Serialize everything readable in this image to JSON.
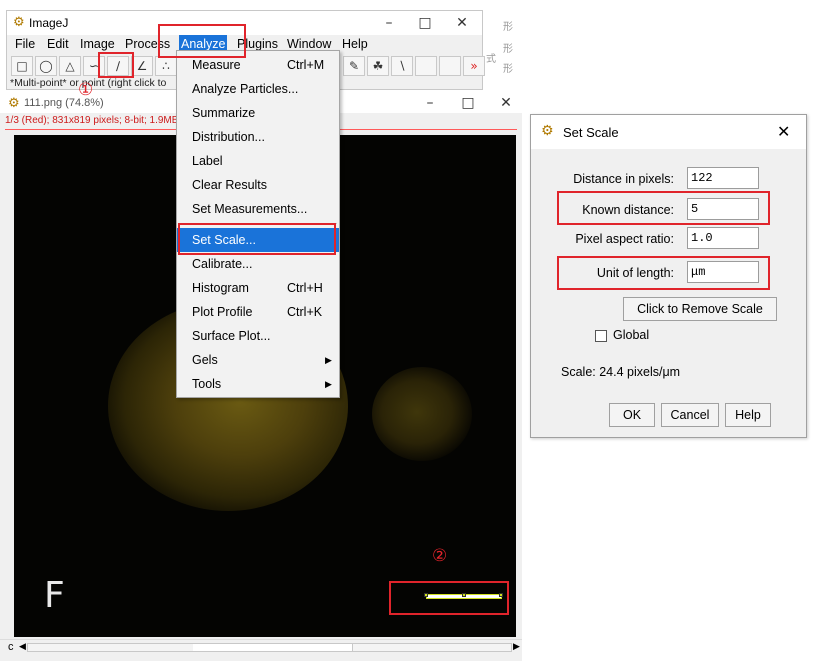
{
  "main_window": {
    "title": "ImageJ",
    "menus": [
      "File",
      "Edit",
      "Image",
      "Process",
      "Analyze",
      "Plugins",
      "Window",
      "Help"
    ],
    "active_menu": "Analyze",
    "status_text": "*Multi-point* or point (right click to"
  },
  "image_window": {
    "title": "111.png (74.8%)",
    "info": "1/3 (Red); 831x819 pixels; 8-bit; 1.9MB",
    "overlay_letter": "F",
    "scroll_left_label": "c"
  },
  "analyze_menu": {
    "items": [
      {
        "label": "Measure",
        "shortcut": "Ctrl+M"
      },
      {
        "label": "Analyze Particles..."
      },
      {
        "label": "Summarize"
      },
      {
        "label": "Distribution..."
      },
      {
        "label": "Label"
      },
      {
        "label": "Clear Results"
      },
      {
        "label": "Set Measurements..."
      },
      {
        "label": "Set Scale...",
        "selected": true
      },
      {
        "label": "Calibrate..."
      },
      {
        "label": "Histogram",
        "shortcut": "Ctrl+H"
      },
      {
        "label": "Plot Profile",
        "shortcut": "Ctrl+K"
      },
      {
        "label": "Surface Plot..."
      },
      {
        "label": "Gels",
        "submenu": true
      },
      {
        "label": "Tools",
        "submenu": true
      }
    ]
  },
  "set_scale_dialog": {
    "title": "Set Scale",
    "distance_in_pixels": {
      "label": "Distance in pixels:",
      "value": "122"
    },
    "known_distance": {
      "label": "Known distance:",
      "value": "5"
    },
    "pixel_aspect_ratio": {
      "label": "Pixel aspect ratio:",
      "value": "1.0"
    },
    "unit_of_length": {
      "label": "Unit of length:",
      "value": "μm"
    },
    "remove_scale_button": "Click to Remove Scale",
    "global_checkbox": {
      "label": "Global",
      "checked": false
    },
    "scale_text": "Scale: 24.4 pixels/μm",
    "ok_button": "OK",
    "cancel_button": "Cancel",
    "help_button": "Help"
  },
  "annotations": {
    "step1": "①",
    "step2": "②"
  },
  "background_fragments": [
    "形",
    "式",
    "形",
    "形"
  ],
  "colors": {
    "highlight": "#1a73d9",
    "annotation_red": "#e0242b",
    "info_red": "#cc1b1b"
  }
}
